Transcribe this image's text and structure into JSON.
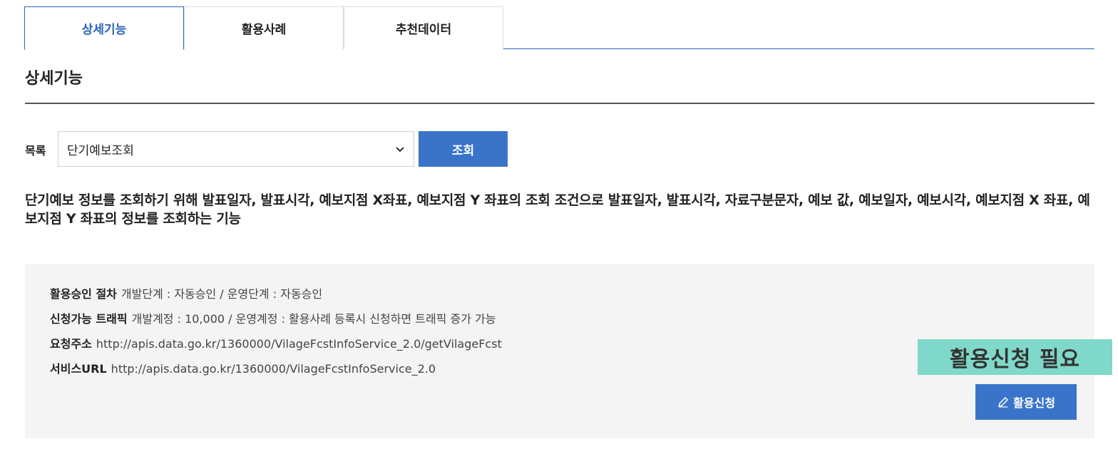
{
  "tabs": [
    {
      "label": "상세기능",
      "active": true
    },
    {
      "label": "활용사례",
      "active": false
    },
    {
      "label": "추천데이터",
      "active": false
    }
  ],
  "section": {
    "title": "상세기능"
  },
  "list": {
    "label": "목록",
    "selected": "단기예보조회",
    "query_button": "조회"
  },
  "description": "단기예보 정보를 조회하기 위해 발표일자, 발표시각, 예보지점 X좌표, 예보지점 Y 좌표의 조회 조건으로 발표일자, 발표시각, 자료구분문자, 예보 값, 예보일자, 예보시각, 예보지점 X 좌표, 예보지점 Y 좌표의 정보를 조회하는 기능",
  "info": {
    "approval_key": "활용승인 절차",
    "approval_value": "개발단계 : 자동승인 / 운영단계 : 자동승인",
    "traffic_key": "신청가능 트래픽",
    "traffic_value": "개발계정 : 10,000 / 운영계정 : 활용사례 등록시 신청하면 트래픽 증가 가능",
    "request_key": "요청주소",
    "request_value": "http://apis.data.go.kr/1360000/VilageFcstInfoService_2.0/getVilageFcst",
    "service_key": "서비스URL",
    "service_value": "http://apis.data.go.kr/1360000/VilageFcstInfoService_2.0"
  },
  "badge": "활용신청 필요",
  "apply_button": "활용신청",
  "colors": {
    "accent": "#3a74c9",
    "active_tab": "#2b63b8",
    "badge_bg": "#7fd8c9",
    "info_bg": "#f4f4f4"
  },
  "icons": {
    "select": "chevron-down-icon",
    "apply": "pencil-icon"
  }
}
